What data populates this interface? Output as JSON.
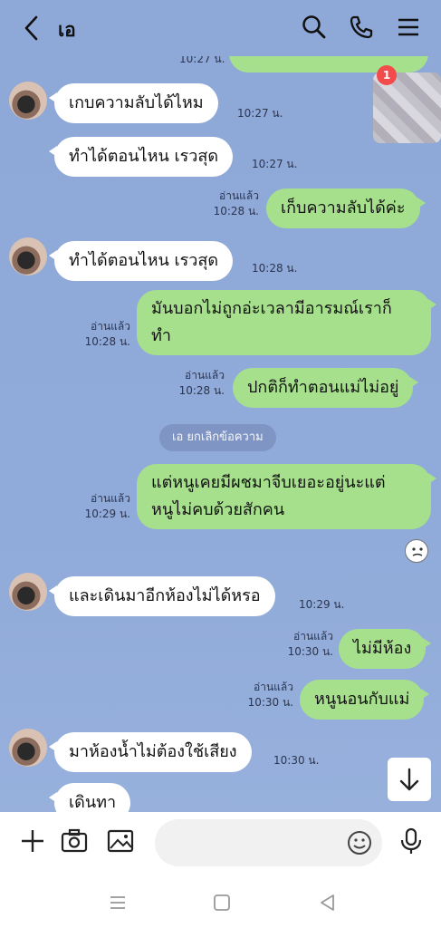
{
  "header": {
    "title": "เอ"
  },
  "messages": {
    "m0_time": "10:27 น.",
    "m1_text": "เกบความลับได้ไหม",
    "m1_time": "10:27 น.",
    "m2_text": "ทำได้ตอนไหน เรวสุด",
    "m2_time": "10:27 น.",
    "m3_text": "เก็บความลับได้ค่ะ",
    "m3_read": "อ่านแล้ว",
    "m3_time": "10:28 น.",
    "m4_text": "ทำได้ตอนไหน เรวสุด",
    "m4_time": "10:28 น.",
    "m5_line1": "มันบอกไม่ถูกอ่ะเวลามีอารมณ์เราก็",
    "m5_line2": "ทำ",
    "m5_read": "อ่านแล้ว",
    "m5_time": "10:28 น.",
    "m6_text": "ปกติก็ทำตอนแม่ไม่อยู่",
    "m6_read": "อ่านแล้ว",
    "m6_time": "10:28 น.",
    "system_notice": "เอ ยกเลิกข้อความ",
    "m7_line1": "แต่หนูเคยมีผชมาจีบเยอะอยู่นะแต่",
    "m7_line2": "หนูไม่คบด้วยสักคน",
    "m7_read": "อ่านแล้ว",
    "m7_time": "10:29 น.",
    "m8_text": "และเดินมาอีกห้องไม่ได้หรอ",
    "m8_time": "10:29 น.",
    "m9_text": "ไม่มีห้อง",
    "m9_read": "อ่านแล้ว",
    "m9_time": "10:30 น.",
    "m10_text": "หนูนอนกับแม่",
    "m10_read": "อ่านแล้ว",
    "m10_time": "10:30 น.",
    "m11_text": "มาห้องน้ำไม่ต้องใช้เสียง",
    "m11_time": "10:30 น.",
    "m12_text": "เดินทา"
  },
  "floating_badge": "1",
  "composer": {
    "placeholder": ""
  },
  "colors": {
    "background": "#8ea8d8",
    "outgoing_bubble": "#a7e08c",
    "incoming_bubble": "#ffffff"
  },
  "icons": [
    "back-icon",
    "search-icon",
    "phone-icon",
    "menu-icon",
    "plus-icon",
    "camera-icon",
    "image-icon",
    "emoji-icon",
    "mic-icon",
    "arrow-down-icon"
  ]
}
